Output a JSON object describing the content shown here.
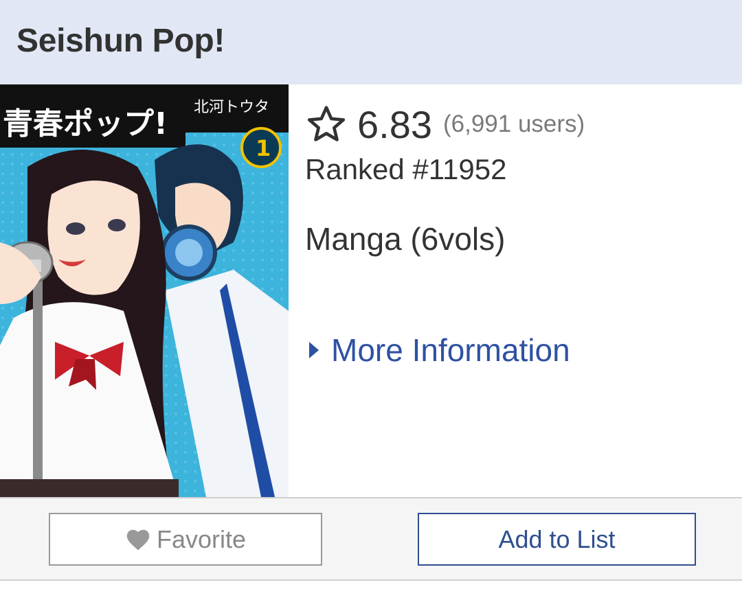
{
  "header": {
    "title": "Seishun Pop!"
  },
  "cover": {
    "title_jp": "青春ポップ!",
    "author_jp": "北河トウタ",
    "volume": "1",
    "icon": "manga-cover-image"
  },
  "stats": {
    "score": "6.83",
    "users": "(6,991 users)",
    "rank": "Ranked #11952",
    "icon": "star-outline-icon"
  },
  "media": {
    "label": "Manga (6vols)"
  },
  "more_info": {
    "label": "More Information",
    "icon": "caret-right-icon"
  },
  "actions": {
    "favorite_label": "Favorite",
    "favorite_icon": "heart-icon",
    "add_label": "Add to List"
  },
  "colors": {
    "header_bg": "#e1e7f5",
    "link": "#2e51a2",
    "add_button": "#2e4f8f",
    "muted": "#888888"
  }
}
